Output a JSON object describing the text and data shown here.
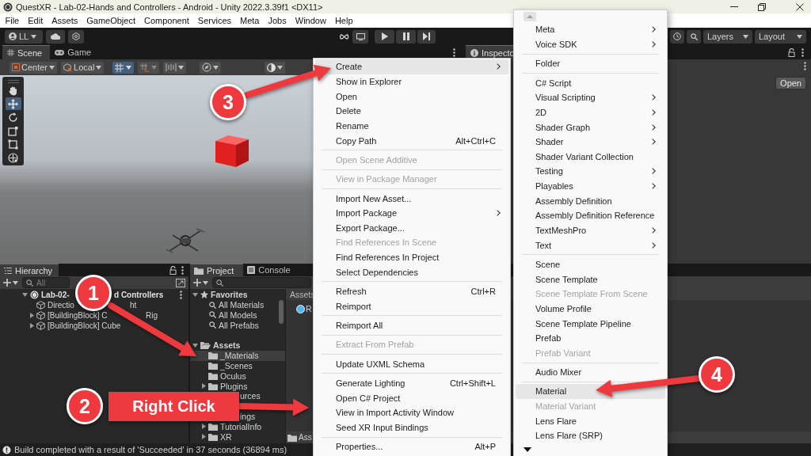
{
  "window": {
    "title": "QuestXR - Lab-02-Hands and Controllers - Android - Unity 2022.3.39f1 <DX11>"
  },
  "menu_bar": [
    "File",
    "Edit",
    "Assets",
    "GameObject",
    "Component",
    "Services",
    "Meta",
    "Jobs",
    "Window",
    "Help"
  ],
  "toolbar": {
    "account": "LL",
    "layers": "Layers",
    "layout": "Layout"
  },
  "scene_view": {
    "tabs": [
      {
        "label": "Scene",
        "selected": true
      },
      {
        "label": "Game",
        "selected": false
      }
    ],
    "pivot": "Center",
    "space": "Local",
    "tools": [
      {
        "kind": "hand",
        "selected": false
      },
      {
        "kind": "move",
        "selected": true
      },
      {
        "kind": "rotate",
        "selected": false
      },
      {
        "kind": "scale",
        "selected": false
      },
      {
        "kind": "rect",
        "selected": false
      },
      {
        "kind": "transform",
        "selected": false
      }
    ]
  },
  "inspector": {
    "tab": "Inspecto",
    "button": "Open"
  },
  "hierarchy": {
    "title": "Hierarchy",
    "search_placeholder": "All",
    "scene": {
      "parts": [
        "Lab-02-",
        "d Controllers"
      ]
    },
    "items": [
      {
        "parts": [
          "Directio",
          "ht"
        ],
        "expandable": false
      },
      {
        "parts": [
          "[BuildingBlock] C",
          "Rig"
        ],
        "expandable": true
      },
      {
        "parts": [
          "[BuildingBlock] Cube"
        ],
        "expandable": true
      }
    ]
  },
  "project": {
    "tabs": [
      {
        "label": "Project",
        "selected": true
      },
      {
        "label": "Console",
        "selected": false
      }
    ],
    "favorites": {
      "title": "Favorites",
      "items": [
        "All Materials",
        "All Models",
        "All Prefabs"
      ]
    },
    "assets": {
      "title": "Assets",
      "folders": [
        {
          "kind": "folder",
          "label": "_Materials",
          "expandable": false,
          "selected": true
        },
        {
          "kind": "folder",
          "label": "_Scenes",
          "expandable": false,
          "selected": false
        },
        {
          "kind": "folder",
          "label": "Oculus",
          "expandable": false,
          "selected": false
        },
        {
          "kind": "folder",
          "label": "Plugins",
          "expandable": true,
          "selected": false
        },
        {
          "kind": "clipped",
          "label": "urces"
        },
        {
          "kind": "clipped",
          "label": "ings"
        },
        {
          "kind": "folder",
          "label": "TutorialInfo",
          "expandable": true,
          "selected": false
        },
        {
          "kind": "folder",
          "label": "XR",
          "expandable": true,
          "selected": false
        }
      ]
    },
    "breadcrumb": "Assets",
    "item": "R",
    "footer": "Ass"
  },
  "context_menu": {
    "items": [
      {
        "kind": "item",
        "label": "Create",
        "submenu": true,
        "disabled": false,
        "selected": true
      },
      {
        "kind": "item",
        "label": "Show in Explorer",
        "submenu": false,
        "disabled": false,
        "selected": false
      },
      {
        "kind": "item",
        "label": "Open",
        "submenu": false,
        "disabled": false,
        "selected": false
      },
      {
        "kind": "item",
        "label": "Delete",
        "submenu": false,
        "disabled": false,
        "selected": false
      },
      {
        "kind": "item",
        "label": "Rename",
        "submenu": false,
        "disabled": false,
        "selected": false
      },
      {
        "kind": "item",
        "label": "Copy Path",
        "shortcut": "Alt+Ctrl+C",
        "submenu": false,
        "disabled": false,
        "selected": false
      },
      {
        "kind": "separator"
      },
      {
        "kind": "item",
        "label": "Open Scene Additive",
        "submenu": false,
        "disabled": true,
        "selected": false
      },
      {
        "kind": "separator"
      },
      {
        "kind": "item",
        "label": "View in Package Manager",
        "submenu": false,
        "disabled": true,
        "selected": false
      },
      {
        "kind": "separator"
      },
      {
        "kind": "item",
        "label": "Import New Asset...",
        "submenu": false,
        "disabled": false,
        "selected": false
      },
      {
        "kind": "item",
        "label": "Import Package",
        "submenu": true,
        "disabled": false,
        "selected": false
      },
      {
        "kind": "item",
        "label": "Export Package...",
        "submenu": false,
        "disabled": false,
        "selected": false
      },
      {
        "kind": "item",
        "label": "Find References In Scene",
        "submenu": false,
        "disabled": true,
        "selected": false
      },
      {
        "kind": "item",
        "label": "Find References In Project",
        "submenu": false,
        "disabled": false,
        "selected": false
      },
      {
        "kind": "item",
        "label": "Select Dependencies",
        "submenu": false,
        "disabled": false,
        "selected": false
      },
      {
        "kind": "separator"
      },
      {
        "kind": "item",
        "label": "Refresh",
        "shortcut": "Ctrl+R",
        "submenu": false,
        "disabled": false,
        "selected": false
      },
      {
        "kind": "item",
        "label": "Reimport",
        "submenu": false,
        "disabled": false,
        "selected": false
      },
      {
        "kind": "separator"
      },
      {
        "kind": "item",
        "label": "Reimport All",
        "submenu": false,
        "disabled": false,
        "selected": false
      },
      {
        "kind": "separator"
      },
      {
        "kind": "item",
        "label": "Extract From Prefab",
        "submenu": false,
        "disabled": true,
        "selected": false
      },
      {
        "kind": "separator"
      },
      {
        "kind": "item",
        "label": "Update UXML Schema",
        "submenu": false,
        "disabled": false,
        "selected": false
      },
      {
        "kind": "separator"
      },
      {
        "kind": "item",
        "label": "Generate Lighting",
        "shortcut": "Ctrl+Shift+L",
        "submenu": false,
        "disabled": false,
        "selected": false
      },
      {
        "kind": "item",
        "label": "Open C# Project",
        "submenu": false,
        "disabled": false,
        "selected": false
      },
      {
        "kind": "item",
        "label": "View in Import Activity Window",
        "submenu": false,
        "disabled": false,
        "selected": false
      },
      {
        "kind": "item",
        "label": "Seed XR Input Bindings",
        "submenu": false,
        "disabled": false,
        "selected": false
      },
      {
        "kind": "separator"
      },
      {
        "kind": "item",
        "label": "Properties...",
        "shortcut": "Alt+P",
        "submenu": false,
        "disabled": false,
        "selected": false
      }
    ]
  },
  "create_submenu": {
    "items": [
      {
        "kind": "item",
        "label": "Meta",
        "submenu": true,
        "disabled": false,
        "selected": false
      },
      {
        "kind": "item",
        "label": "Voice SDK",
        "submenu": true,
        "disabled": false,
        "selected": false
      },
      {
        "kind": "separator"
      },
      {
        "kind": "item",
        "label": "Folder",
        "submenu": false,
        "disabled": false,
        "selected": false
      },
      {
        "kind": "separator"
      },
      {
        "kind": "item",
        "label": "C# Script",
        "submenu": false,
        "disabled": false,
        "selected": false
      },
      {
        "kind": "item",
        "label": "Visual Scripting",
        "submenu": true,
        "disabled": false,
        "selected": false
      },
      {
        "kind": "item",
        "label": "2D",
        "submenu": true,
        "disabled": false,
        "selected": false
      },
      {
        "kind": "item",
        "label": "Shader Graph",
        "submenu": true,
        "disabled": false,
        "selected": false
      },
      {
        "kind": "item",
        "label": "Shader",
        "submenu": true,
        "disabled": false,
        "selected": false
      },
      {
        "kind": "item",
        "label": "Shader Variant Collection",
        "submenu": false,
        "disabled": false,
        "selected": false
      },
      {
        "kind": "item",
        "label": "Testing",
        "submenu": true,
        "disabled": false,
        "selected": false
      },
      {
        "kind": "item",
        "label": "Playables",
        "submenu": true,
        "disabled": false,
        "selected": false
      },
      {
        "kind": "item",
        "label": "Assembly Definition",
        "submenu": false,
        "disabled": false,
        "selected": false
      },
      {
        "kind": "item",
        "label": "Assembly Definition Reference",
        "submenu": false,
        "disabled": false,
        "selected": false
      },
      {
        "kind": "item",
        "label": "TextMeshPro",
        "submenu": true,
        "disabled": false,
        "selected": false
      },
      {
        "kind": "item",
        "label": "Text",
        "submenu": true,
        "disabled": false,
        "selected": false
      },
      {
        "kind": "separator"
      },
      {
        "kind": "item",
        "label": "Scene",
        "submenu": false,
        "disabled": false,
        "selected": false
      },
      {
        "kind": "item",
        "label": "Scene Template",
        "submenu": false,
        "disabled": false,
        "selected": false
      },
      {
        "kind": "item",
        "label": "Scene Template From Scene",
        "submenu": false,
        "disabled": true,
        "selected": false
      },
      {
        "kind": "item",
        "label": "Volume Profile",
        "submenu": false,
        "disabled": false,
        "selected": false
      },
      {
        "kind": "item",
        "label": "Scene Template Pipeline",
        "submenu": false,
        "disabled": false,
        "selected": false
      },
      {
        "kind": "item",
        "label": "Prefab",
        "submenu": false,
        "disabled": false,
        "selected": false
      },
      {
        "kind": "item",
        "label": "Prefab Variant",
        "submenu": false,
        "disabled": true,
        "selected": false
      },
      {
        "kind": "separator"
      },
      {
        "kind": "item",
        "label": "Audio Mixer",
        "submenu": false,
        "disabled": false,
        "selected": false
      },
      {
        "kind": "separator"
      },
      {
        "kind": "item",
        "label": "Material",
        "submenu": false,
        "disabled": false,
        "selected": true
      },
      {
        "kind": "item",
        "label": "Material Variant",
        "submenu": false,
        "disabled": true,
        "selected": false
      },
      {
        "kind": "item",
        "label": "Lens Flare",
        "submenu": false,
        "disabled": false,
        "selected": false
      },
      {
        "kind": "item",
        "label": "Lens Flare (SRP)",
        "submenu": false,
        "disabled": false,
        "selected": false
      }
    ]
  },
  "annotations": {
    "badges": [
      {
        "number": "1"
      },
      {
        "number": "2"
      },
      {
        "number": "3"
      },
      {
        "number": "4"
      }
    ],
    "callout": "Right Click"
  },
  "status_bar": {
    "message": "Build completed with a result of 'Succeeded' in 37 seconds (36894 ms)"
  }
}
